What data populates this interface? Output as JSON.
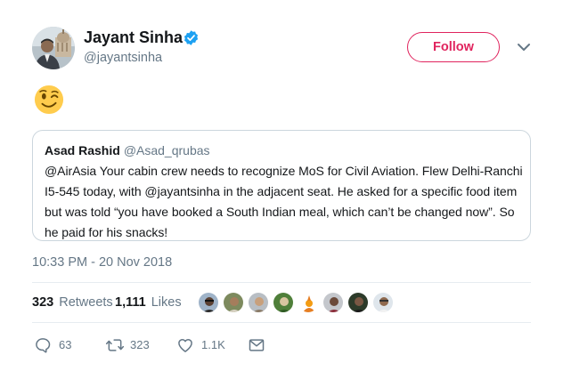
{
  "author": {
    "name": "Jayant Sinha",
    "handle": "@jayantsinha",
    "verified": true
  },
  "follow_label": "Follow",
  "tweet_emoji": "winking-face",
  "quoted_tweet": {
    "name": "Asad Rashid",
    "handle": "@Asad_qrubas",
    "lines": [
      "@AirAsia Your cabin crew needs to recognize MoS for Civil Aviation. Flew Delhi-Ranchi",
      "I5-545 today, with @jayantsinha in the adjacent seat. He asked for a specific food item",
      "but was told “you have booked a South Indian meal, which can’t be changed now”. So",
      "he paid for his snacks!"
    ]
  },
  "timestamp": "10:33 PM - 20 Nov 2018",
  "stats": {
    "retweets_count": "323",
    "retweets_label": "Retweets",
    "likes_count": "1,111",
    "likes_label": "Likes"
  },
  "actions": {
    "replies": "63",
    "retweets": "323",
    "likes": "1.1K"
  },
  "colors": {
    "accent_pink": "#e0245e",
    "verified_blue": "#1da1f2",
    "secondary_text": "#657786",
    "border": "#ccd6dd"
  }
}
